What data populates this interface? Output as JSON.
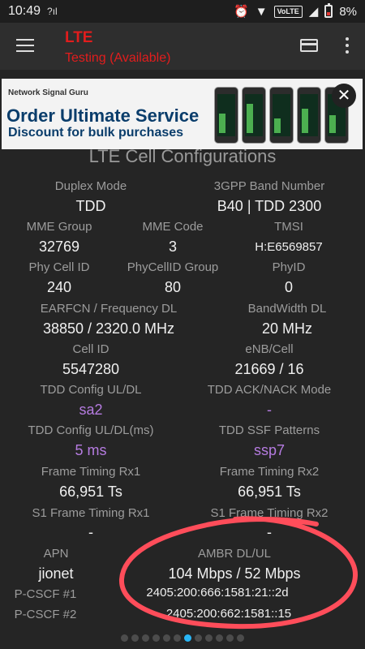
{
  "status_bar": {
    "time": "10:49",
    "left_icon": "?ıl",
    "volte": "VoLTE",
    "battery": "8%",
    "icons": [
      "alarm-icon",
      "wifi-icon",
      "signal-icon",
      "battery-icon"
    ]
  },
  "app_bar": {
    "title": "LTE",
    "subtitle": "Testing (Available)",
    "accent_color": "#e21d1d"
  },
  "ad": {
    "brand": "Network Signal Guru",
    "headline": "Order Ultimate Service",
    "subheadline": "Discount for bulk purchases",
    "close_label": "✕"
  },
  "section_heading": "LTE Cell Configurations",
  "fields": [
    {
      "label": "Duplex Mode",
      "value": "TDD"
    },
    {
      "label": "3GPP Band Number",
      "value": "B40 | TDD 2300"
    },
    {
      "label": "MME Group",
      "value": "32769"
    },
    {
      "label": "MME Code",
      "value": "3"
    },
    {
      "label": "TMSI",
      "value": "H:E6569857"
    },
    {
      "label": "Phy Cell ID",
      "value": "240"
    },
    {
      "label": "PhyCellID Group",
      "value": "80"
    },
    {
      "label": "PhyID",
      "value": "0"
    },
    {
      "label": "EARFCN / Frequency DL",
      "value": "38850 / 2320.0 MHz"
    },
    {
      "label": "BandWidth DL",
      "value": "20 MHz"
    },
    {
      "label": "Cell ID",
      "value": "5547280"
    },
    {
      "label": "eNB/Cell",
      "value": "21669 / 16"
    },
    {
      "label": "TDD Config UL/DL",
      "value": "sa2"
    },
    {
      "label": "TDD ACK/NACK Mode",
      "value": "-"
    },
    {
      "label": "TDD Config UL/DL(ms)",
      "value": "5 ms"
    },
    {
      "label": "TDD SSF Patterns",
      "value": "ssp7"
    },
    {
      "label": "Frame Timing Rx1",
      "value": "66,951 Ts"
    },
    {
      "label": "Frame Timing Rx2",
      "value": "66,951 Ts"
    },
    {
      "label": "S1 Frame Timing Rx1",
      "value": "-"
    },
    {
      "label": "S1 Frame Timing Rx2",
      "value": "-"
    },
    {
      "label": "APN",
      "value": "jionet"
    },
    {
      "label": "AMBR DL/UL",
      "value": "104 Mbps / 52 Mbps"
    },
    {
      "label": "P-CSCF #1",
      "value": "2405:200:666:1581:21::2d"
    },
    {
      "label": "P-CSCF #2",
      "value": "2405:200:662:1581::15"
    }
  ],
  "pager": {
    "count": 12,
    "active": 6,
    "active_color": "#29b6f6"
  }
}
